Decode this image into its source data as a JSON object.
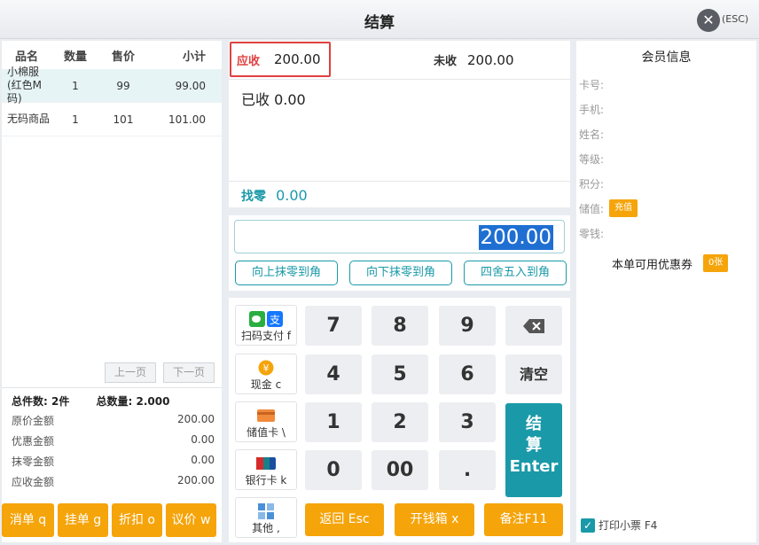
{
  "window": {
    "title": "结算",
    "esc_label": "(ESC)"
  },
  "cart": {
    "headers": [
      "品名",
      "数量",
      "售价",
      "小计"
    ],
    "rows": [
      {
        "name": "小棉服(红色M码)",
        "qty": "1",
        "price": "99",
        "subtotal": "99.00"
      },
      {
        "name": "无码商品",
        "qty": "1",
        "price": "101",
        "subtotal": "101.00"
      }
    ],
    "pager": {
      "prev": "上一页",
      "next": "下一页"
    },
    "summary": {
      "total_items": "总件数: 2件",
      "total_qty": "总数量: 2.000",
      "rows": [
        {
          "label": "原价金额",
          "value": "200.00"
        },
        {
          "label": "优惠金额",
          "value": "0.00"
        },
        {
          "label": "抹零金额",
          "value": "0.00"
        },
        {
          "label": "应收金额",
          "value": "200.00"
        }
      ]
    }
  },
  "ops": [
    {
      "label": "消单 q"
    },
    {
      "label": "挂单 g"
    },
    {
      "label": "折扣 o"
    },
    {
      "label": "议价 w"
    }
  ],
  "amounts": {
    "due_label": "应收",
    "due": "200.00",
    "unpaid_label": "未收",
    "unpaid": "200.00",
    "paid_label": "已收",
    "paid": "0.00",
    "change_label": "找零",
    "change": "0.00"
  },
  "input": {
    "value": "200.00"
  },
  "rounding": [
    {
      "label": "向上抹零到角"
    },
    {
      "label": "向下抹零到角"
    },
    {
      "label": "四舍五入到角"
    }
  ],
  "payments": [
    {
      "label": "扫码支付 f",
      "icon": "wechat-alipay-icon"
    },
    {
      "label": "现金 c",
      "icon": "cash-icon"
    },
    {
      "label": "储值卡 \\",
      "icon": "stored-card-icon"
    },
    {
      "label": "银行卡 k",
      "icon": "bank-card-icon"
    },
    {
      "label": "其他 ,",
      "icon": "grid-icon"
    }
  ],
  "keypad": {
    "keys": [
      "7",
      "8",
      "9",
      "4",
      "5",
      "6",
      "1",
      "2",
      "3",
      "0",
      "00",
      "."
    ],
    "backspace_icon": "backspace-icon",
    "clear": "清空",
    "enter": [
      "结",
      "算",
      "Enter"
    ]
  },
  "bottom": [
    {
      "label": "返回 Esc"
    },
    {
      "label": "开钱箱 x"
    },
    {
      "label": "备注F11"
    }
  ],
  "member": {
    "title": "会员信息",
    "fields": [
      "卡号:",
      "手机:",
      "姓名:",
      "等级:",
      "积分:",
      "储值:",
      "零钱:"
    ],
    "recharge": "充值",
    "coupon_label": "本单可用优惠券",
    "coupon_badge": "0张",
    "print_label": "打印小票 F4"
  },
  "colors": {
    "accent": "#1a99a8",
    "orange": "#f5a40a",
    "red": "#e04040"
  }
}
